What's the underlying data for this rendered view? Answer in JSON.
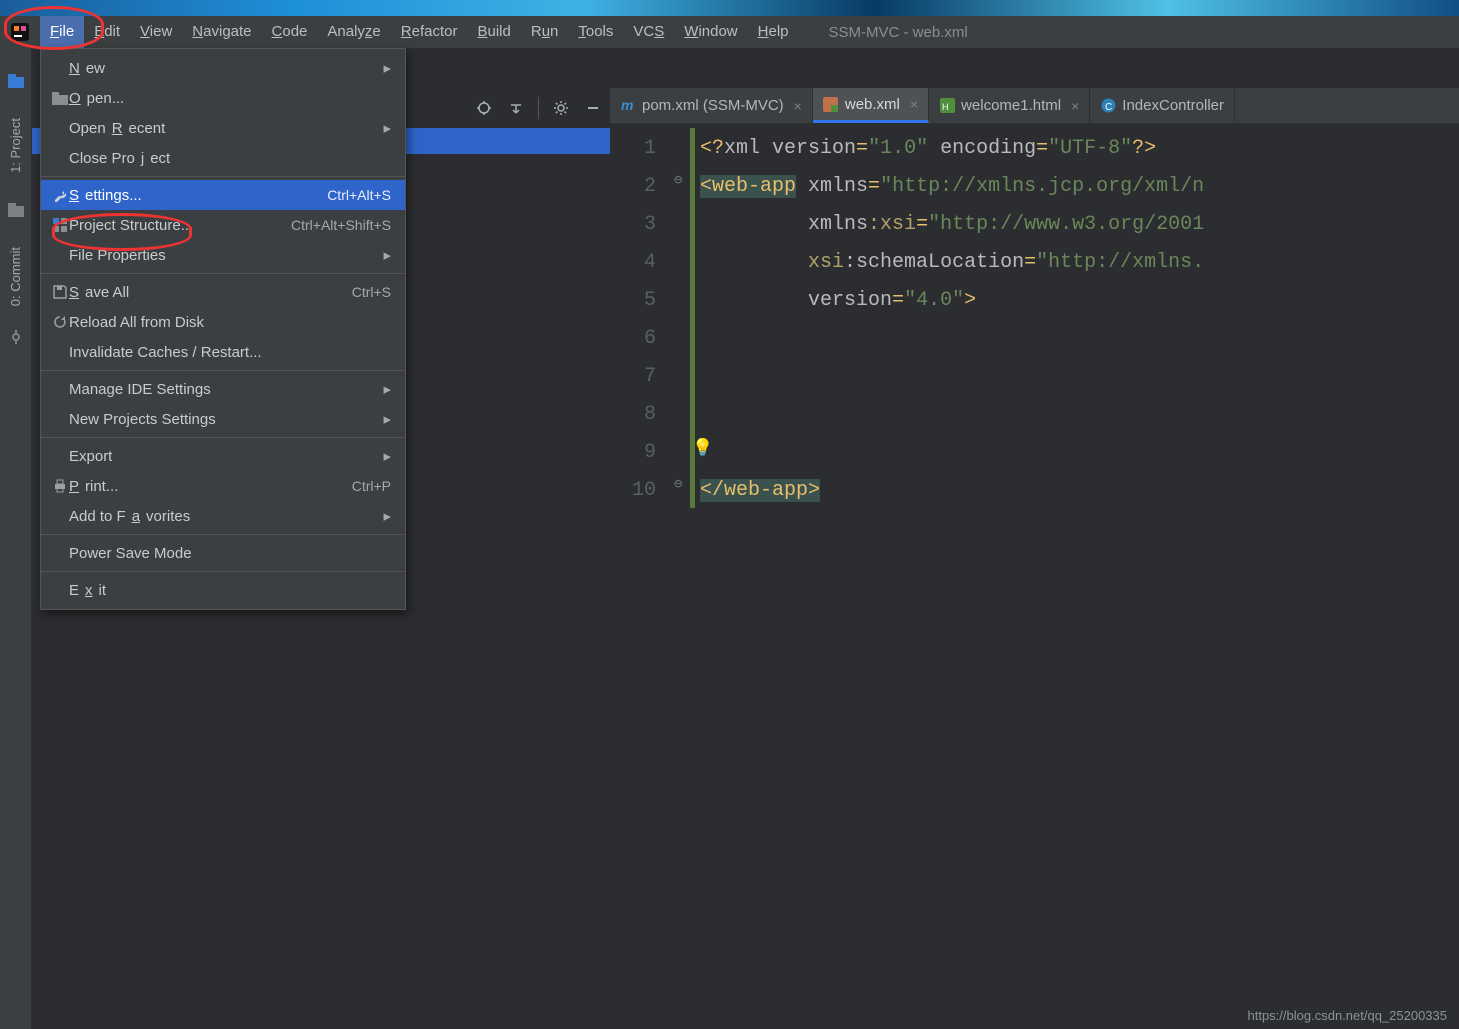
{
  "window_title": "SSM-MVC - web.xml",
  "menubar": [
    "File",
    "Edit",
    "View",
    "Navigate",
    "Code",
    "Analyze",
    "Refactor",
    "Build",
    "Run",
    "Tools",
    "VCS",
    "Window",
    "Help"
  ],
  "left_gutter": {
    "project": "1: Project",
    "commit": "0: Commit"
  },
  "dropdown": [
    {
      "label": "New",
      "submenu": true
    },
    {
      "label": "Open...",
      "icon": "folder"
    },
    {
      "label": "Open Recent",
      "submenu": true
    },
    {
      "label": "Close Project"
    },
    {
      "sep": true
    },
    {
      "label": "Settings...",
      "shortcut": "Ctrl+Alt+S",
      "icon": "wrench",
      "highlight": true
    },
    {
      "label": "Project Structure...",
      "shortcut": "Ctrl+Alt+Shift+S",
      "icon": "structure"
    },
    {
      "label": "File Properties",
      "submenu": true
    },
    {
      "sep": true
    },
    {
      "label": "Save All",
      "shortcut": "Ctrl+S",
      "icon": "save"
    },
    {
      "label": "Reload All from Disk",
      "icon": "reload"
    },
    {
      "label": "Invalidate Caches / Restart..."
    },
    {
      "sep": true
    },
    {
      "label": "Manage IDE Settings",
      "submenu": true
    },
    {
      "label": "New Projects Settings",
      "submenu": true
    },
    {
      "sep": true
    },
    {
      "label": "Export",
      "submenu": true
    },
    {
      "label": "Print...",
      "shortcut": "Ctrl+P",
      "icon": "print"
    },
    {
      "label": "Add to Favorites",
      "submenu": true
    },
    {
      "sep": true
    },
    {
      "label": "Power Save Mode"
    },
    {
      "sep": true
    },
    {
      "label": "Exit"
    }
  ],
  "tabs": [
    {
      "label": "pom.xml (SSM-MVC)",
      "icon": "m",
      "active": false
    },
    {
      "label": "web.xml",
      "icon": "xml",
      "active": true
    },
    {
      "label": "welcome1.html",
      "icon": "html",
      "active": false
    },
    {
      "label": "IndexController",
      "icon": "class",
      "active": false
    }
  ],
  "code_lines": [
    "<?xml version=\"1.0\" encoding=\"UTF-8\"?>",
    "<web-app xmlns=\"http://xmlns.jcp.org/xml/n",
    "         xmlns:xsi=\"http://www.w3.org/2001",
    "         xsi:schemaLocation=\"http://xmlns.",
    "         version=\"4.0\">",
    "",
    "",
    "",
    "",
    "</web-app>"
  ],
  "watermark": "https://blog.csdn.net/qq_25200335"
}
